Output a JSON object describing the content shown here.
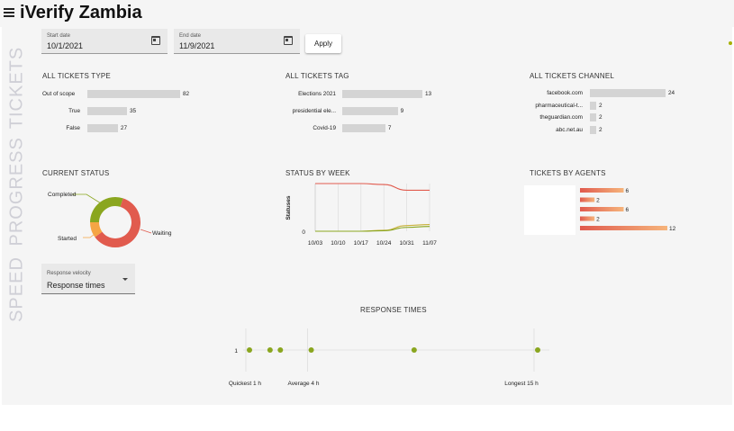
{
  "app": {
    "title": "iVerify Zambia"
  },
  "sections": {
    "tickets": "TICKETS",
    "progress": "PROGRESS",
    "speed": "SPEED"
  },
  "filters": {
    "start_label": "Start date",
    "start_value": "10/1/2021",
    "end_label": "End date",
    "end_value": "11/9/2021",
    "apply_label": "Apply"
  },
  "tickets_type": {
    "title": "ALL TICKETS TYPE",
    "rows": [
      {
        "label": "Out of scope",
        "value": 82
      },
      {
        "label": "True",
        "value": 35
      },
      {
        "label": "False",
        "value": 27
      }
    ]
  },
  "tickets_tag": {
    "title": "ALL TICKETS TAG",
    "rows": [
      {
        "label": "Elections 2021",
        "value": 13
      },
      {
        "label": "presidential ele...",
        "value": 9
      },
      {
        "label": "Covid-19",
        "value": 7
      }
    ]
  },
  "tickets_channel": {
    "title": "ALL TICKETS CHANNEL",
    "rows": [
      {
        "label": "facebook.com",
        "value": 24
      },
      {
        "label": "pharmaceutical-t...",
        "value": 2
      },
      {
        "label": "theguardian.com",
        "value": 2
      },
      {
        "label": "abc.net.au",
        "value": 2
      }
    ]
  },
  "current_status": {
    "title": "CURRENT STATUS",
    "labels": {
      "completed": "Completed",
      "started": "Started",
      "waiting": "Waiting"
    },
    "colors": {
      "completed": "#8aa61f",
      "started": "#f5a544",
      "waiting": "#e15b4e"
    }
  },
  "status_by_week": {
    "title": "STATUS BY WEEK",
    "ylabel": "Statuses",
    "y_tick": "0",
    "x_ticks": [
      "10/03",
      "10/10",
      "10/17",
      "10/24",
      "10/31",
      "11/07"
    ]
  },
  "tickets_by_agents": {
    "title": "TICKETS BY AGENTS",
    "rows": [
      {
        "value": 6,
        "label": "6"
      },
      {
        "value": 2,
        "label": "2"
      },
      {
        "value": 6,
        "label": "6"
      },
      {
        "value": 2,
        "label": "2"
      },
      {
        "value": 12,
        "label": "12"
      }
    ],
    "colors": {
      "start": "#e05a4e",
      "end": "#f6b47b"
    }
  },
  "speed": {
    "select_label": "Response velocity",
    "select_value": "Response times"
  },
  "response_times": {
    "title": "RESPONSE TIMES",
    "y_label": "1",
    "quickest": "Quickest 1 h",
    "average": "Average 4 h",
    "longest": "Longest 15 h",
    "dot_color": "#8aa61f"
  },
  "chart_data": [
    {
      "type": "bar",
      "title": "ALL TICKETS TYPE",
      "categories": [
        "Out of scope",
        "True",
        "False"
      ],
      "values": [
        82,
        35,
        27
      ]
    },
    {
      "type": "bar",
      "title": "ALL TICKETS TAG",
      "categories": [
        "Elections 2021",
        "presidential ele...",
        "Covid-19"
      ],
      "values": [
        13,
        9,
        7
      ]
    },
    {
      "type": "bar",
      "title": "ALL TICKETS CHANNEL",
      "categories": [
        "facebook.com",
        "pharmaceutical-t...",
        "theguardian.com",
        "abc.net.au"
      ],
      "values": [
        24,
        2,
        2,
        2
      ]
    },
    {
      "type": "pie",
      "title": "CURRENT STATUS",
      "categories": [
        "Completed",
        "Started",
        "Waiting"
      ],
      "values": [
        30,
        10,
        60
      ]
    },
    {
      "type": "line",
      "title": "STATUS BY WEEK",
      "ylabel": "Statuses",
      "x": [
        "10/03",
        "10/10",
        "10/17",
        "10/24",
        "10/31",
        "11/07"
      ],
      "series": [
        {
          "color": "#e15b4e",
          "values": [
            100,
            100,
            100,
            98,
            86,
            86
          ]
        },
        {
          "color": "#c9b13c",
          "values": [
            0,
            0,
            0,
            2,
            12,
            14
          ]
        },
        {
          "color": "#8aa61f",
          "values": [
            0,
            0,
            0,
            1,
            8,
            10
          ]
        }
      ]
    },
    {
      "type": "bar",
      "title": "TICKETS BY AGENTS",
      "values": [
        6,
        2,
        6,
        2,
        12
      ]
    },
    {
      "type": "scatter",
      "title": "RESPONSE TIMES",
      "x": [
        1,
        2,
        2.5,
        4,
        9,
        15
      ],
      "y": [
        1,
        1,
        1,
        1,
        1,
        1
      ]
    }
  ]
}
